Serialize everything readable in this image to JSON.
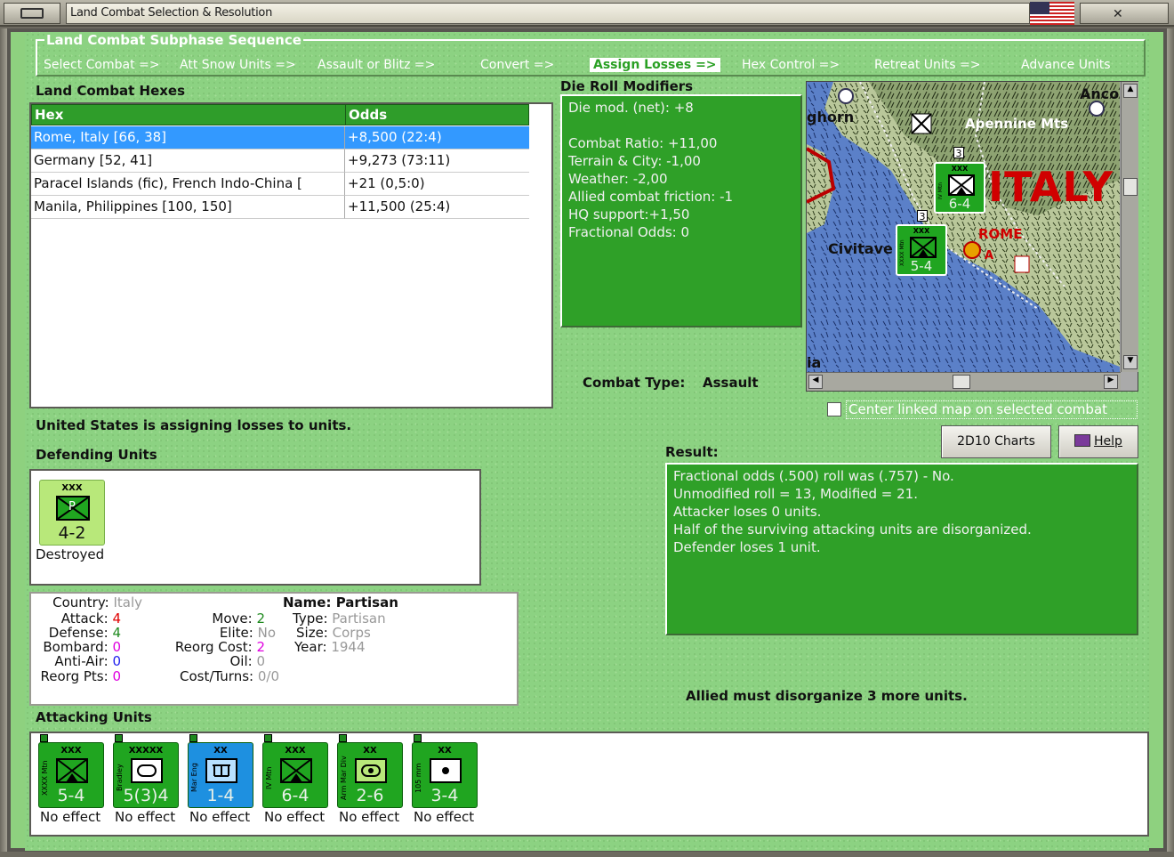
{
  "window": {
    "title": "Land Combat Selection & Resolution"
  },
  "sequence": {
    "title": "Land Combat Subphase Sequence",
    "steps": [
      {
        "label": "Select Combat =>"
      },
      {
        "label": "Att Snow Units =>"
      },
      {
        "label": "Assault or Blitz =>"
      },
      {
        "label": "Convert =>"
      },
      {
        "label": "Assign Losses =>"
      },
      {
        "label": "Hex Control =>"
      },
      {
        "label": "Retreat Units =>"
      },
      {
        "label": "Advance Units"
      }
    ],
    "active_index": 4
  },
  "hexes": {
    "title": "Land Combat Hexes",
    "col_hex": "Hex",
    "col_odds": "Odds",
    "rows": [
      {
        "hex": "Rome, Italy [66, 38]",
        "odds": "+8,500 (22:4)",
        "selected": true
      },
      {
        "hex": "Germany [52, 41]",
        "odds": "+9,273 (73:11)",
        "selected": false
      },
      {
        "hex": "Paracel Islands (fic), French Indo-China [",
        "odds": "+21 (0,5:0)",
        "selected": false
      },
      {
        "hex": "Manila, Philippines [100, 150]",
        "odds": "+11,500 (25:4)",
        "selected": false
      }
    ]
  },
  "die_roll": {
    "title": "Die Roll Modifiers",
    "net": "Die mod. (net): +8",
    "lines": [
      "Combat Ratio: +11,00",
      "Terrain & City: -1,00",
      "Weather: -2,00",
      "Allied combat friction: -1",
      "HQ support:+1,50",
      "Fractional Odds: 0"
    ]
  },
  "combat_type": {
    "label": "Combat Type:",
    "value": "Assault"
  },
  "map": {
    "labels": {
      "ancona": "Anco",
      "apennine": "Apennine Mts",
      "italy": "ITALY",
      "rome": "ROME",
      "civita": "Civitave",
      "ghorn": "ghorn",
      "ia": "ia"
    },
    "unit1": {
      "size": "XXX",
      "name": "IV Mtn",
      "factors": "6-4",
      "stack": "3"
    },
    "unit2": {
      "size": "XXX",
      "name": "XXXX Mtn",
      "factors": "5-4",
      "stack": "3"
    },
    "rome_marker": "A",
    "center_linked": "Center linked map on selected combat"
  },
  "status": "United States is assigning losses to units.",
  "defending": {
    "title": "Defending Units",
    "units": [
      {
        "size": "XXX",
        "sym": "P",
        "factors": "4-2",
        "result": "Destroyed"
      }
    ]
  },
  "unit_info": {
    "country_label": "Country:",
    "country": "Italy",
    "attack_label": "Attack:",
    "attack": "4",
    "defense_label": "Defense:",
    "defense": "4",
    "bombard_label": "Bombard:",
    "bombard": "0",
    "antiair_label": "Anti-Air:",
    "antiair": "0",
    "reorgpts_label": "Reorg Pts:",
    "reorgpts": "0",
    "move_label": "Move:",
    "move": "2",
    "elite_label": "Elite:",
    "elite": "No",
    "reorgcost_label": "Reorg Cost:",
    "reorgcost": "2",
    "oil_label": "Oil:",
    "oil": "0",
    "costturns_label": "Cost/Turns:",
    "costturns": "0/0",
    "name_label": "Name:",
    "name": "Partisan",
    "type_label": "Type:",
    "type": "Partisan",
    "size_label": "Size:",
    "size": "Corps",
    "year_label": "Year:",
    "year": "1944"
  },
  "buttons": {
    "charts": "2D10 Charts",
    "help": "Help"
  },
  "result": {
    "title": "Result:",
    "lines": [
      "Fractional odds (.500) roll was (.757)  - No.",
      "Unmodified roll = 13, Modified = 21.",
      "Attacker loses 0 units.",
      "Half of the surviving attacking units are disorganized.",
      "Defender loses 1 unit."
    ]
  },
  "disorg_msg": "Allied must disorganize 3 more units.",
  "attacking": {
    "title": "Attacking Units",
    "units": [
      {
        "size": "XXX",
        "name": "XXXX Mtn",
        "factors": "5-4",
        "result": "No effect",
        "color": "#20a520",
        "sym": "inf"
      },
      {
        "size": "XXXXX",
        "name": "Bradley",
        "factors": "5(3)4",
        "result": "No effect",
        "color": "#20a520",
        "sym": "arm"
      },
      {
        "size": "XX",
        "name": "Mar Eng",
        "factors": "1-4",
        "result": "No effect",
        "color": "#1e90e0",
        "sym": "eng"
      },
      {
        "size": "XXX",
        "name": "IV Mtn",
        "factors": "6-4",
        "result": "No effect",
        "color": "#20a520",
        "sym": "inf"
      },
      {
        "size": "XX",
        "name": "Arm Mar Div",
        "factors": "2-6",
        "result": "No effect",
        "color": "#20a520",
        "sym": "arm2"
      },
      {
        "size": "XX",
        "name": "105 mm",
        "factors": "3-4",
        "result": "No effect",
        "color": "#20a520",
        "sym": "art"
      }
    ]
  }
}
